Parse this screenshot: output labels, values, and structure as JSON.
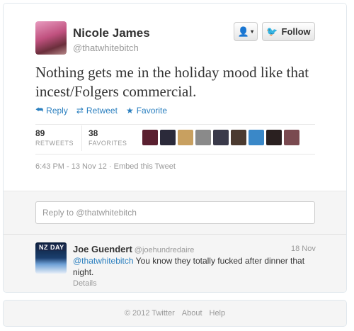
{
  "tweet": {
    "author_name": "Nicole James",
    "author_handle": "@thatwhitebitch",
    "follow_label": "Follow",
    "text": "Nothing gets me in the holiday mood like that incest/Folgers commercial.",
    "actions": {
      "reply": "Reply",
      "retweet": "Retweet",
      "favorite": "Favorite"
    },
    "stats": {
      "retweets": "89",
      "retweets_label": "RETWEETS",
      "favorites": "38",
      "favorites_label": "FAVORITES"
    },
    "timestamp": "6:43 PM - 13 Nov 12",
    "embed": "Embed this Tweet",
    "favoriter_avatars": [
      "#5a2030",
      "#2b2a3a",
      "#c8a060",
      "#8a8a8a",
      "#3a3a4a",
      "#4b3a30",
      "#3a88c8",
      "#2a2020",
      "#7a4a50"
    ]
  },
  "reply_box": {
    "placeholder": "Reply to @thatwhitebitch"
  },
  "reply": {
    "name": "Joe Guendert",
    "handle": "@joehundredaire",
    "date": "18 Nov",
    "mention": "@thatwhitebitch",
    "text": " You know they totally fucked after dinner that night.",
    "details": "Details",
    "avatar_badge": "NZ DAY"
  },
  "footer": {
    "copyright": "© 2012 Twitter",
    "about": "About",
    "help": "Help"
  }
}
